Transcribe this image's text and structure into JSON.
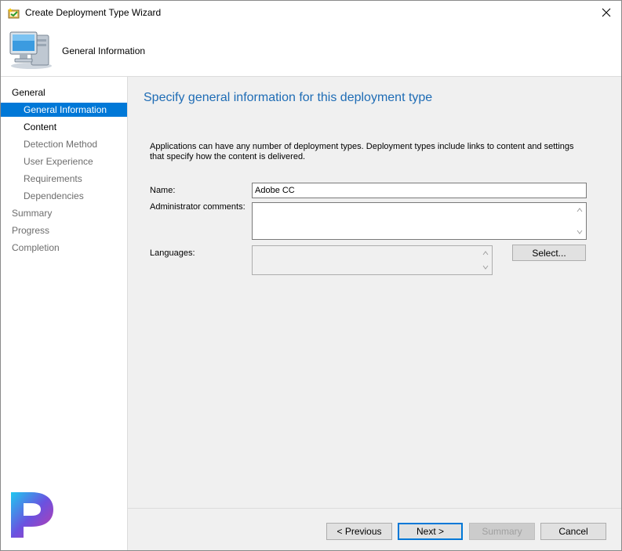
{
  "window": {
    "title": "Create Deployment Type Wizard",
    "close_icon": "close-icon",
    "icon": "wizard-icon"
  },
  "header": {
    "title": "General Information",
    "icon": "computer-icon"
  },
  "sidebar": {
    "items": [
      {
        "label": "General",
        "state": "group"
      },
      {
        "label": "General Information",
        "state": "selected"
      },
      {
        "label": "Content",
        "state": "done"
      },
      {
        "label": "Detection Method",
        "state": "pending"
      },
      {
        "label": "User Experience",
        "state": "pending"
      },
      {
        "label": "Requirements",
        "state": "pending"
      },
      {
        "label": "Dependencies",
        "state": "pending"
      },
      {
        "label": "Summary",
        "state": "group-pending"
      },
      {
        "label": "Progress",
        "state": "group-pending"
      },
      {
        "label": "Completion",
        "state": "group-pending"
      }
    ],
    "logo_text": "P",
    "logo_icon": "brand-logo-icon"
  },
  "main": {
    "title": "Specify general information for this deployment type",
    "description": "Applications can have any number of deployment types. Deployment types include links to content and settings that specify how the content is delivered.",
    "name_label": "Name:",
    "name_value": "Adobe CC",
    "comments_label": "Administrator comments:",
    "comments_value": "",
    "languages_label": "Languages:",
    "languages_value": "",
    "select_button": "Select..."
  },
  "footer": {
    "previous": "< Previous",
    "next": "Next >",
    "summary": "Summary",
    "cancel": "Cancel"
  },
  "colors": {
    "accent": "#0078d7",
    "title_blue": "#1e6cb5",
    "panel_bg": "#f0f0f0"
  }
}
